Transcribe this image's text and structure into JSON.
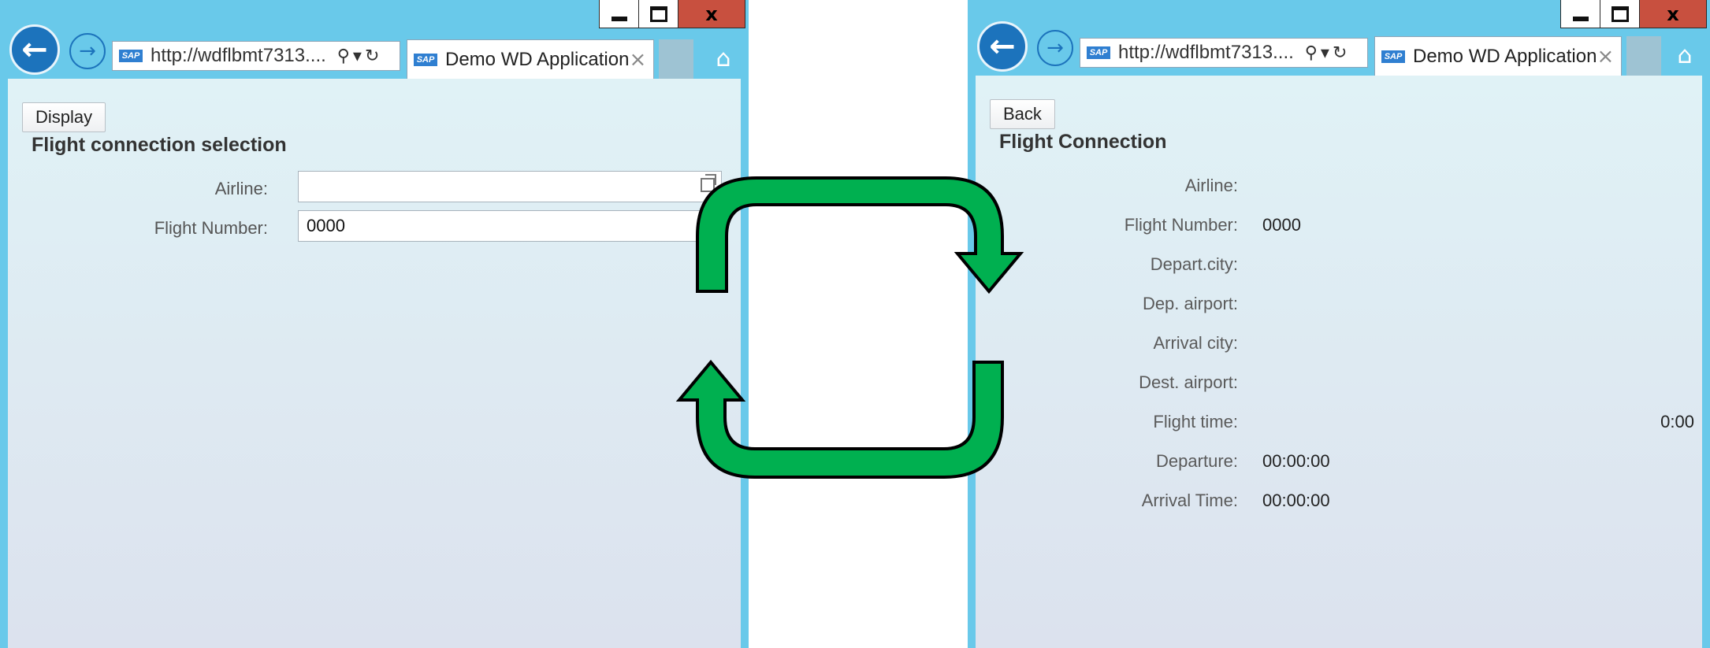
{
  "left_window": {
    "address": "http://wdflbmt7313....",
    "tab_title": "Demo WD Application",
    "button_label": "Display",
    "section_title": "Flight connection selection",
    "fields": [
      {
        "label": "Airline:",
        "value": ""
      },
      {
        "label": "Flight Number:",
        "value": "0000"
      }
    ]
  },
  "right_window": {
    "address": "http://wdflbmt7313....",
    "tab_title": "Demo WD Application",
    "button_label": "Back",
    "section_title": "Flight Connection",
    "fields": [
      {
        "label": "Airline:",
        "value": ""
      },
      {
        "label": "Flight Number:",
        "value": "0000"
      },
      {
        "label": "Depart.city:",
        "value": ""
      },
      {
        "label": "Dep. airport:",
        "value": ""
      },
      {
        "label": "Arrival city:",
        "value": ""
      },
      {
        "label": "Dest. airport:",
        "value": ""
      },
      {
        "label": "Flight time:",
        "value": "0:00"
      },
      {
        "label": "Departure:",
        "value": "00:00:00"
      },
      {
        "label": "Arrival Time:",
        "value": "00:00:00"
      }
    ]
  },
  "icons": {
    "back": "back-arrow-icon",
    "forward": "forward-arrow-icon",
    "search": "search-icon",
    "refresh": "refresh-icon",
    "home": "home-icon",
    "value_help": "value-help-icon",
    "cycle": "cycle-arrows-icon"
  },
  "colors": {
    "chrome": "#69c9ea",
    "arrow_fill": "#00b050",
    "close_button": "#c8503f",
    "back_button": "#1c73bc"
  }
}
